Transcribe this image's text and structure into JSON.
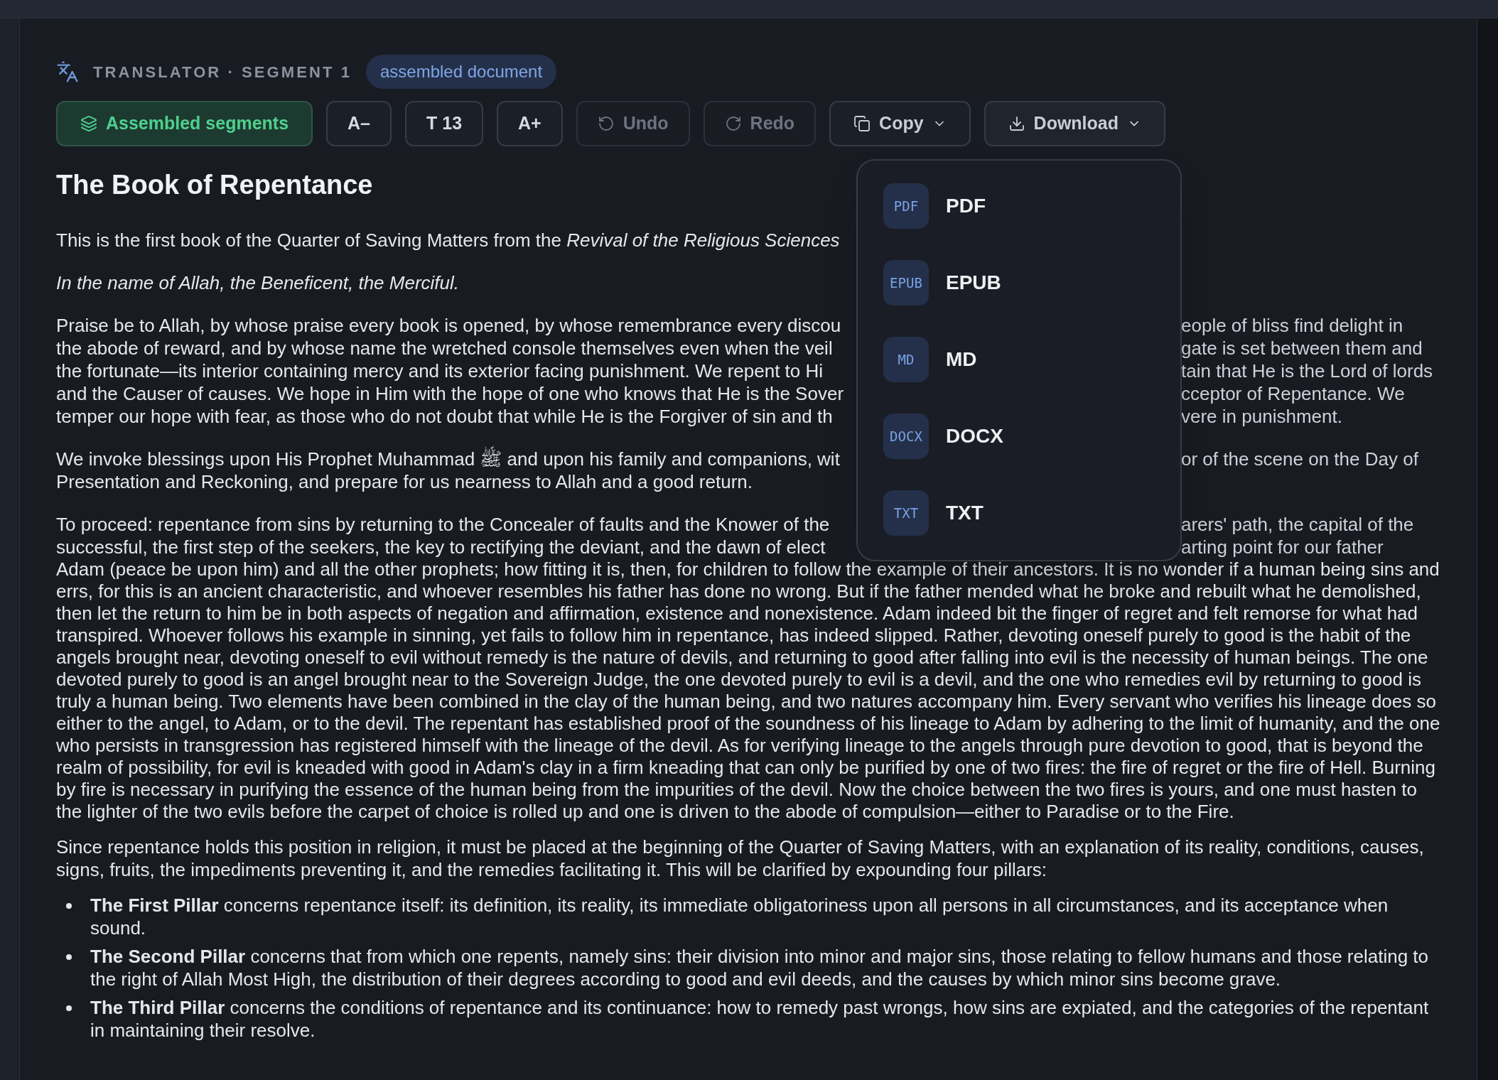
{
  "header": {
    "title": "TRANSLATOR · SEGMENT 1",
    "badge": "assembled document"
  },
  "toolbar": [
    {
      "kind": "toggle",
      "label": "Assembled segments",
      "on": true
    },
    {
      "kind": "text",
      "label": "A–"
    },
    {
      "kind": "text",
      "label": "T 13"
    },
    {
      "kind": "text",
      "label": "A+"
    },
    {
      "kind": "undo",
      "label": "Undo",
      "disabled": true
    },
    {
      "kind": "redo",
      "label": "Redo",
      "disabled": true
    },
    {
      "kind": "copy",
      "label": "Copy",
      "expanded": false
    },
    {
      "kind": "download",
      "label": "Download",
      "expanded": true
    }
  ],
  "download_menu": [
    {
      "tag": "PDF",
      "label": "PDF"
    },
    {
      "tag": "EPUB",
      "label": "EPUB"
    },
    {
      "tag": "MD",
      "label": "MD"
    },
    {
      "tag": "DOCX",
      "label": "DOCX"
    },
    {
      "tag": "TXT",
      "label": "TXT"
    }
  ],
  "document": {
    "title": "The Book of Repentance",
    "paragraphs": [
      {
        "kind": "covered",
        "lines": [
          {
            "left": "This is the first book of the Quarter of Saving Matters from the *Revival of the Religious Sciences*"
          }
        ]
      },
      {
        "kind": "italic",
        "text": "In the name of Allah, the Beneficent, the Merciful."
      },
      {
        "kind": "covered",
        "lines": [
          {
            "left": "Praise be to Allah, by whose praise every book is opened, by whose remembrance every discou",
            "right": "eople of bliss find delight in"
          },
          {
            "left": "the abode of reward, and by whose name the wretched console themselves even when the veil",
            "right": "gate is set between them and"
          },
          {
            "left": "the fortunate—its interior containing mercy and its exterior facing punishment. We repent to Hi",
            "right": "tain that He is the Lord of lords"
          },
          {
            "left": "and the Causer of causes. We hope in Him with the hope of one who knows that He is the Sover",
            "right": "cceptor of Repentance. We"
          },
          {
            "left": "temper our hope with fear, as those who do not doubt that while He is the Forgiver of sin and th",
            "right": "vere in punishment."
          }
        ]
      },
      {
        "kind": "covered",
        "lines": [
          {
            "left": "We invoke blessings upon His Prophet Muhammad ﷺ and upon his family and companions, wit",
            "right": "or of the scene on the Day of"
          }
        ],
        "rest": "Presentation and Reckoning, and prepare for us nearness to Allah and a good return."
      },
      {
        "kind": "covered",
        "lines": [
          {
            "left": "To proceed: repentance from sins by returning to the Concealer of faults and the Knower of the",
            "right": "arers' path, the capital of the"
          },
          {
            "left": "successful, the first step of the seekers, the key to rectifying the deviant, and the dawn of elect",
            "right": "arting point for our father"
          }
        ],
        "rest": "Adam (peace be upon him) and all the other prophets; how fitting it is, then, for children to follow the example of their ancestors. It is no wonder if a human being sins and errs, for this is an ancient characteristic, and whoever resembles his father has done no wrong. But if the father mended what he broke and rebuilt what he demolished, then let the return to him be in both aspects of negation and affirmation, existence and nonexistence. Adam indeed bit the finger of regret and felt remorse for what had transpired. Whoever follows his example in sinning, yet fails to follow him in repentance, has indeed slipped. Rather, devoting oneself purely to good is the habit of the angels brought near, devoting oneself to evil without remedy is the nature of devils, and returning to good after falling into evil is the necessity of human beings. The one devoted purely to good is an angel brought near to the Sovereign Judge, the one devoted purely to evil is a devil, and the one who remedies evil by returning to good is truly a human being. Two elements have been combined in the clay of the human being, and two natures accompany him. Every servant who verifies his lineage does so either to the angel, to Adam, or to the devil. The repentant has established proof of the soundness of his lineage to Adam by adhering to the limit of humanity, and the one who persists in transgression has registered himself with the lineage of the devil. As for verifying lineage to the angels through pure devotion to good, that is beyond the realm of possibility, for evil is kneaded with good in Adam's clay in a firm kneading that can only be purified by one of two fires: the fire of regret or the fire of Hell. Burning by fire is necessary in purifying the essence of the human being from the impurities of the devil. Now the choice between the two fires is yours, and one must hasten to the lighter of the two evils before the carpet of choice is rolled up and one is driven to the abode of compulsion—either to Paradise or to the Fire."
      },
      {
        "kind": "plain",
        "text": "Since repentance holds this position in religion, it must be placed at the beginning of the Quarter of Saving Matters, with an explanation of its reality, conditions, causes, signs, fruits, the impediments preventing it, and the remedies facilitating it. This will be clarified by expounding four pillars:"
      }
    ],
    "pillars": [
      "**The First Pillar** concerns repentance itself: its definition, its reality, its immediate obligatoriness upon all persons in all circumstances, and its acceptance when sound.",
      "**The Second Pillar** concerns that from which one repents, namely sins: their division into minor and major sins, those relating to fellow humans and those relating to the right of Allah Most High, the distribution of their degrees according to good and evil deeds, and the causes by which minor sins become grave.",
      "**The Third Pillar** concerns the conditions of repentance and its continuance: how to remedy past wrongs, how sins are expiated, and the categories of the repentant in maintaining their resolve."
    ]
  }
}
